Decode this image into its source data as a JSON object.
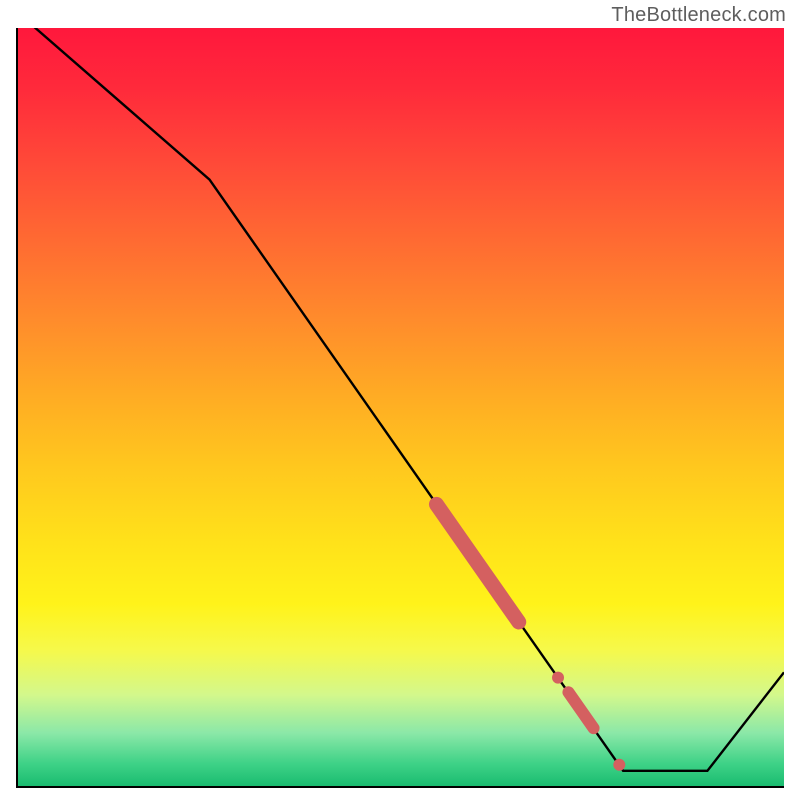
{
  "watermark": "TheBottleneck.com",
  "colors": {
    "line": "#000000",
    "marker": "#d46060"
  },
  "chart_data": {
    "type": "line",
    "title": "",
    "xlabel": "",
    "ylabel": "",
    "xlim": [
      0,
      100
    ],
    "ylim": [
      0,
      100
    ],
    "grid": false,
    "line_points": [
      {
        "x": 0,
        "y": 102
      },
      {
        "x": 25,
        "y": 80
      },
      {
        "x": 79,
        "y": 2
      },
      {
        "x": 90,
        "y": 2
      },
      {
        "x": 100,
        "y": 15
      }
    ],
    "markers": [
      {
        "x": 60.0,
        "y": 29.4,
        "size": "thick-segment",
        "angle_deg": 55
      },
      {
        "x": 70.5,
        "y": 14.3,
        "size": "dot",
        "r": 6
      },
      {
        "x": 73.5,
        "y": 10.0,
        "size": "short-segment",
        "angle_deg": 55
      },
      {
        "x": 78.5,
        "y": 2.8,
        "size": "dot",
        "r": 6
      }
    ]
  }
}
